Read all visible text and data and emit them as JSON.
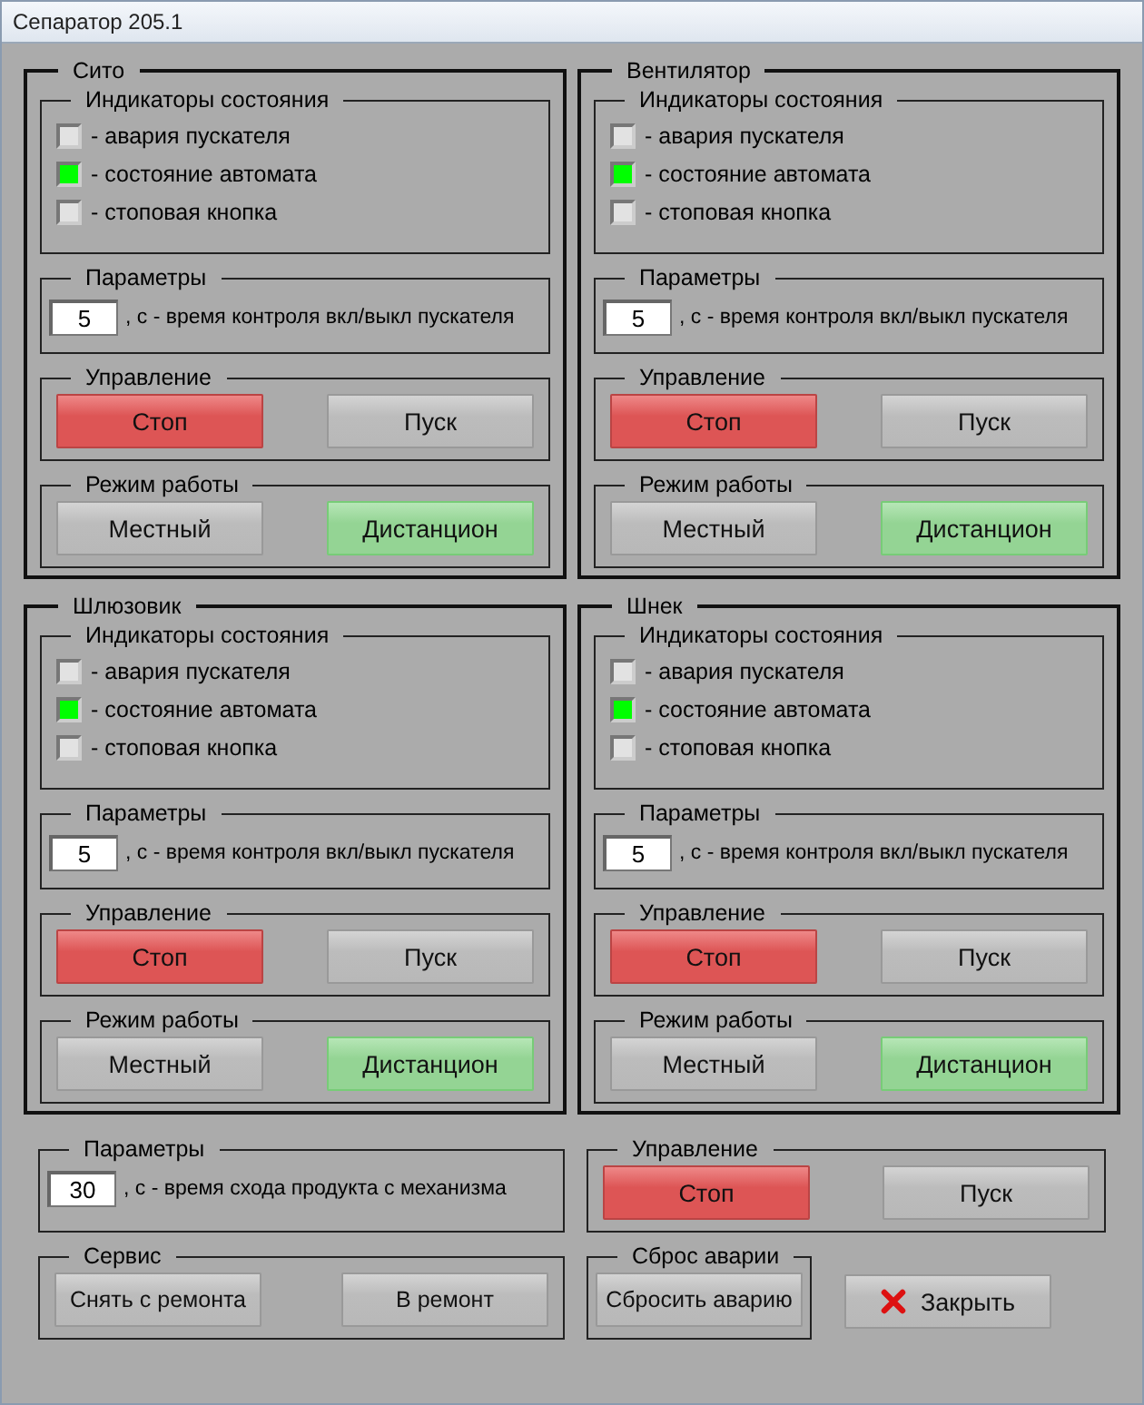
{
  "window": {
    "title": "Сепаратор 205.1"
  },
  "units": [
    {
      "title": "Сито",
      "indicators": {
        "title": "Индикаторы состояния",
        "items": [
          {
            "label": "- авария пускателя",
            "on": false
          },
          {
            "label": "- состояние автомата",
            "on": true
          },
          {
            "label": "- стоповая кнопка",
            "on": false
          }
        ]
      },
      "parameters": {
        "title": "Параметры",
        "value": "5",
        "label": ", с - время контроля вкл/выкл пускателя"
      },
      "control": {
        "title": "Управление",
        "buttons": [
          {
            "label": "Стоп",
            "kind": "stop"
          },
          {
            "label": "Пуск",
            "kind": "plain"
          }
        ]
      },
      "mode": {
        "title": "Режим работы",
        "buttons": [
          {
            "label": "Местный",
            "selected": false
          },
          {
            "label": "Дистанцион",
            "selected": true
          }
        ]
      }
    },
    {
      "title": "Вентилятор",
      "indicators": {
        "title": "Индикаторы состояния",
        "items": [
          {
            "label": "- авария пускателя",
            "on": false
          },
          {
            "label": "- состояние автомата",
            "on": true
          },
          {
            "label": "- стоповая кнопка",
            "on": false
          }
        ]
      },
      "parameters": {
        "title": "Параметры",
        "value": "5",
        "label": ", с - время контроля вкл/выкл пускателя"
      },
      "control": {
        "title": "Управление",
        "buttons": [
          {
            "label": "Стоп",
            "kind": "stop"
          },
          {
            "label": "Пуск",
            "kind": "plain"
          }
        ]
      },
      "mode": {
        "title": "Режим работы",
        "buttons": [
          {
            "label": "Местный",
            "selected": false
          },
          {
            "label": "Дистанцион",
            "selected": true
          }
        ]
      }
    },
    {
      "title": "Шлюзовик",
      "indicators": {
        "title": "Индикаторы состояния",
        "items": [
          {
            "label": "- авария пускателя",
            "on": false
          },
          {
            "label": "- состояние автомата",
            "on": true
          },
          {
            "label": "- стоповая кнопка",
            "on": false
          }
        ]
      },
      "parameters": {
        "title": "Параметры",
        "value": "5",
        "label": ", с - время контроля вкл/выкл пускателя"
      },
      "control": {
        "title": "Управление",
        "buttons": [
          {
            "label": "Стоп",
            "kind": "stop"
          },
          {
            "label": "Пуск",
            "kind": "plain"
          }
        ]
      },
      "mode": {
        "title": "Режим работы",
        "buttons": [
          {
            "label": "Местный",
            "selected": false
          },
          {
            "label": "Дистанцион",
            "selected": true
          }
        ]
      }
    },
    {
      "title": "Шнек",
      "indicators": {
        "title": "Индикаторы состояния",
        "items": [
          {
            "label": "- авария пускателя",
            "on": false
          },
          {
            "label": "- состояние автомата",
            "on": true
          },
          {
            "label": "- стоповая кнопка",
            "on": false
          }
        ]
      },
      "parameters": {
        "title": "Параметры",
        "value": "5",
        "label": ", с - время контроля вкл/выкл пускателя"
      },
      "control": {
        "title": "Управление",
        "buttons": [
          {
            "label": "Стоп",
            "kind": "stop"
          },
          {
            "label": "Пуск",
            "kind": "plain"
          }
        ]
      },
      "mode": {
        "title": "Режим работы",
        "buttons": [
          {
            "label": "Местный",
            "selected": false
          },
          {
            "label": "Дистанцион",
            "selected": true
          }
        ]
      }
    }
  ],
  "parameters": {
    "title": "Параметры",
    "value": "30",
    "label": ", с - время схода продукта с механизма"
  },
  "control": {
    "title": "Управление",
    "buttons": [
      {
        "label": "Стоп",
        "kind": "stop"
      },
      {
        "label": "Пуск",
        "kind": "plain"
      }
    ]
  },
  "service": {
    "title": "Сервис",
    "buttons": [
      {
        "label": "Снять с ремонта"
      },
      {
        "label": "В ремонт"
      }
    ]
  },
  "reset": {
    "title": "Сброс аварии",
    "button": "Сбросить аварию"
  },
  "close_button": {
    "label": "Закрыть"
  }
}
